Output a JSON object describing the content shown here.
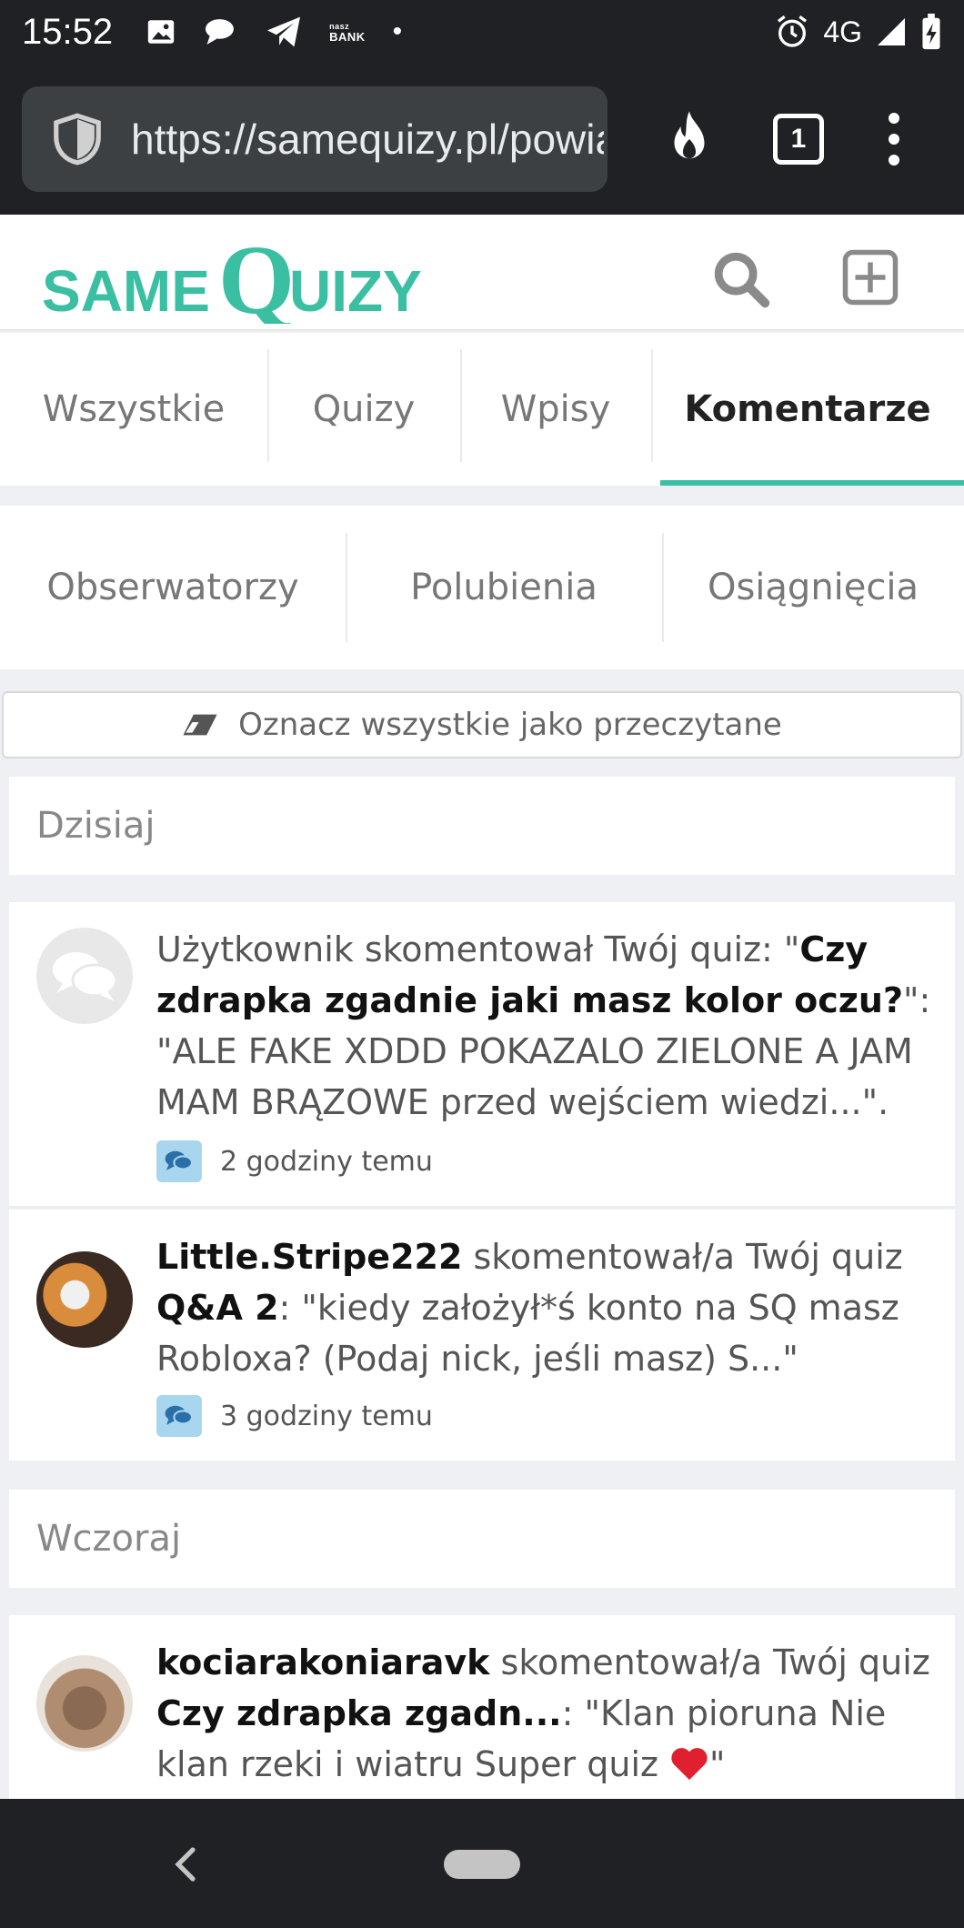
{
  "status_bar": {
    "time": "15:52",
    "bank_line1": "nasz",
    "bank_line2": "BANK",
    "dot": "•",
    "network": "4G"
  },
  "browser": {
    "url": "https://samequizy.pl/powiadomienia",
    "tab_count": "1"
  },
  "site": {
    "logo_same": "SAME",
    "logo_q": "Q",
    "logo_uizy": "UIZY",
    "brand_color": "#3bbfa2"
  },
  "tabs": [
    {
      "label": "Wszystkie"
    },
    {
      "label": "Quizy"
    },
    {
      "label": "Wpisy"
    },
    {
      "label": "Komentarze"
    }
  ],
  "subtabs": [
    {
      "label": "Obserwatorzy"
    },
    {
      "label": "Polubienia"
    },
    {
      "label": "Osiągnięcia"
    }
  ],
  "mark_all_read": "Oznacz wszystkie jako przeczytane",
  "sections": {
    "today": "Dzisiaj",
    "yesterday": "Wczoraj"
  },
  "notifications": [
    {
      "actor": "Użytkownik",
      "action": " skomentował Twój quiz: \"",
      "target": "Czy zdrapka zgadnie jaki masz kolor oczu?",
      "text": "\": \"ALE FAKE XDDD POKAZALO ZIELONE A JAM MAM BRĄZOWE przed wejściem wiedzi...\".",
      "time": "2 godziny temu"
    },
    {
      "actor": "Little.Stripe222",
      "action": " skomentował/a Twój quiz ",
      "target": "Q&A 2",
      "text": ": \"kiedy założył*ś konto na SQ masz Robloxa? (Podaj nick, jeśli masz) S...\"",
      "time": "3 godziny temu"
    },
    {
      "actor": "kociarakoniaravk",
      "action": " skomentował/a Twój quiz ",
      "target": "Czy zdrapka zgadn...",
      "text": ": \"Klan pioruna Nie klan rzeki i wiatru Super quiz ",
      "text_end": "\""
    }
  ]
}
